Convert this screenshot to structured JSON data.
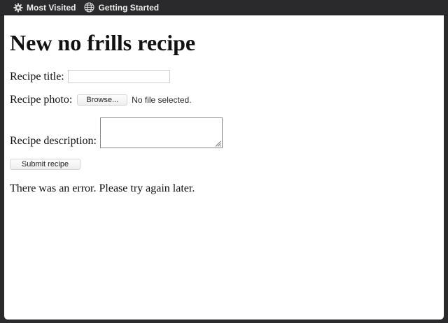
{
  "bookmarks": [
    {
      "label": "Most Visited",
      "icon": "gear-icon"
    },
    {
      "label": "Getting Started",
      "icon": "globe-icon"
    }
  ],
  "page": {
    "title": "New no frills recipe",
    "form": {
      "title_label": "Recipe title:",
      "title_value": "",
      "photo_label": "Recipe photo:",
      "browse_label": "Browse...",
      "file_status": "No file selected.",
      "description_label": "Recipe description:",
      "description_value": "",
      "submit_label": "Submit recipe"
    },
    "error_message": "There was an error. Please try again later."
  }
}
